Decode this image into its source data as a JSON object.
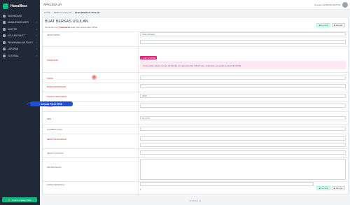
{
  "brand": {
    "name": "Hosalibox"
  },
  "sidebar": {
    "items": [
      {
        "label": "DASHBOARD",
        "icon": "dashboard-icon",
        "has_chevron": false
      },
      {
        "label": "MANAJEMEN USER",
        "icon": "users-icon",
        "has_chevron": true
      },
      {
        "label": "MASTER",
        "icon": "database-icon",
        "has_chevron": true
      },
      {
        "label": "USULAN PAKET",
        "icon": "file-icon",
        "has_chevron": true
      },
      {
        "label": "PENGEMBALIAN PAKET",
        "icon": "return-icon",
        "has_chevron": true
      },
      {
        "label": "LAPORAN",
        "icon": "report-icon",
        "has_chevron": true
      },
      {
        "label": "TUTORIAL",
        "icon": "book-icon",
        "has_chevron": true
      }
    ],
    "lock_button": "Kunci Lengkapi Data"
  },
  "topbar": {
    "app_title": "APKLISIA JA",
    "user_name": "Operator ADMINISTRATOR"
  },
  "breadcrumb": [
    "HOME",
    "BERKAS USULAN",
    "BUAT BERKAS USULAN"
  ],
  "page": {
    "title": "BUAT BERKAS USULAN",
    "subtitle_pre": "Tanda lain ke",
    "subtitle_highlight": "(*) Berwarna",
    "subtitle_post": "wajib diisi sesuai data SPSE",
    "btn_kembali": "Kembali",
    "btn_simpan": "Simpan"
  },
  "form": {
    "jenis_paket": {
      "label": "JENIS PAKET",
      "value": "Paket Seleksi"
    },
    "kode_rup": {
      "label": "KODE RUP",
      "badge": "Cari di SPSE",
      "info": "Untuk paket dapat di isi ke APKLISIA JA saat data dari SIRUP dan melakukan pengisian kode RUP SPSE"
    },
    "kode_tender": {
      "label": "KODE"
    },
    "nama_pekerjaan": {
      "label": "NAMA PEKERJAAN"
    },
    "tahun_anggaran": {
      "label": "TAHUN ANGGARAN",
      "value": "2026"
    },
    "pagu": {
      "label": "PAGU"
    },
    "hps": {
      "label": "HPS",
      "value": "Rp 0,00"
    },
    "sumber_dana": {
      "label": "SUMBER DANA"
    },
    "jenis_pengadaan": {
      "label": "JENIS PENGADAAN"
    },
    "jenis_kontrak": {
      "label": "JENIS KONTRAK"
    },
    "keterangan": {
      "label": "KETERANGAN"
    },
    "kode_rekening": {
      "label": "KODE REKENING"
    }
  },
  "tooltip": "Isi Kode Paket SPSE",
  "footer": "APKLISIA JA"
}
